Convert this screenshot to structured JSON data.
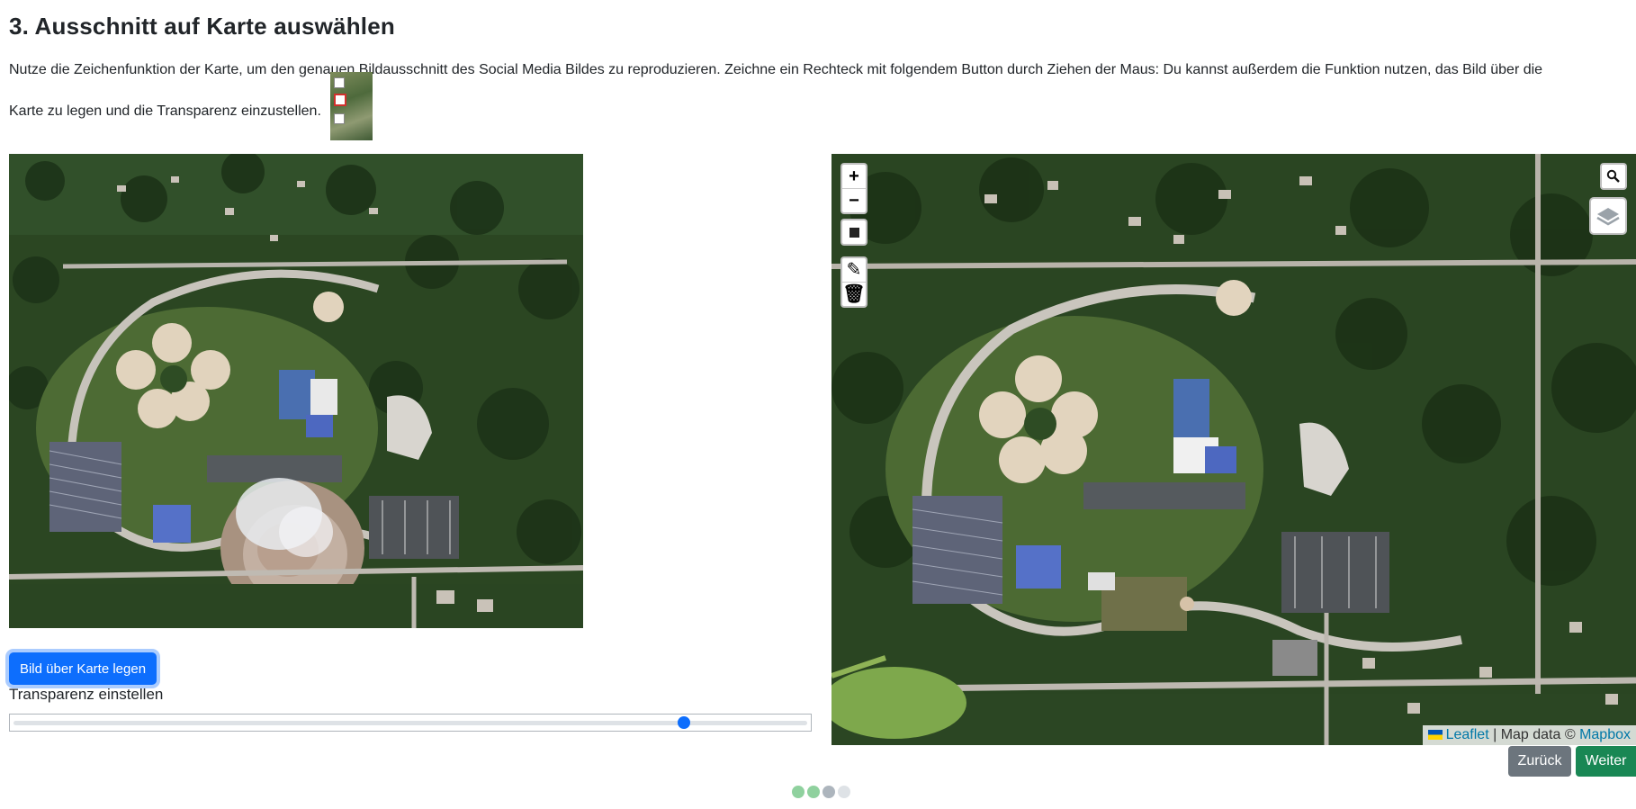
{
  "page": {
    "title": "3. Ausschnitt auf Karte auswählen",
    "instruction_line1": "Nutze die Zeichenfunktion der Karte, um den genauen Bildausschnitt des Social Media Bildes zu reproduzieren. Zeichne ein Rechteck mit folgendem Button durch Ziehen der Maus: Du kannst außerdem die Funktion nutzen, das Bild über die",
    "instruction_line2": "Karte zu legen und die Transparenz einzustellen."
  },
  "left_panel": {
    "overlay_button": "Bild über Karte legen",
    "transparency_label": "Transparenz einstellen",
    "transparency_value": 0.85
  },
  "map": {
    "zoom_in": "+",
    "zoom_out": "−",
    "icons": [
      "zoom-in-icon",
      "zoom-out-icon",
      "draw-rectangle-icon",
      "edit-layers-icon",
      "delete-icon",
      "search-icon",
      "layers-icon",
      "ukraine-flag-icon"
    ],
    "attribution": {
      "leaflet": "Leaflet",
      "separator": " | Map data © ",
      "mapbox": "Mapbox"
    }
  },
  "navigation": {
    "back": "Zurück",
    "next": "Weiter",
    "steps": [
      {
        "state": "done",
        "color": "#8fd19e"
      },
      {
        "state": "done",
        "color": "#8fd19e"
      },
      {
        "state": "current",
        "color": "#adb5bd"
      },
      {
        "state": "todo",
        "color": "#dee2e6"
      }
    ]
  }
}
